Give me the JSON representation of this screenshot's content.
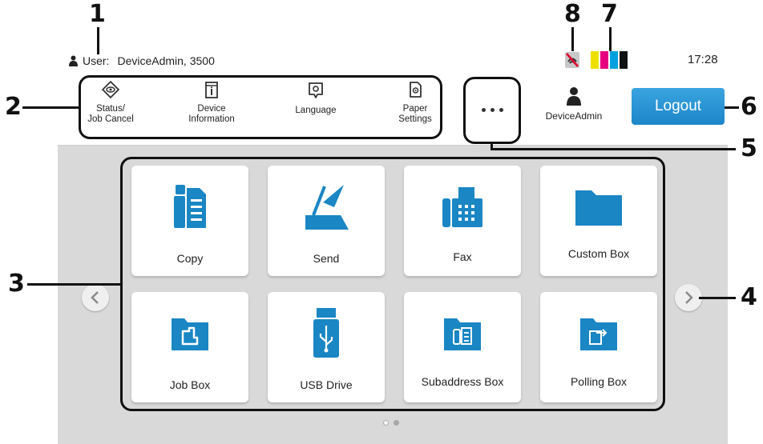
{
  "status_bar": {
    "user_label": "User:",
    "user_value": "DeviceAdmin, 3500",
    "time": "17:28"
  },
  "quick_settings": [
    {
      "label_line1": "Status/",
      "label_line2": "Job Cancel",
      "icon": "status-eye-icon"
    },
    {
      "label_line1": "Device",
      "label_line2": "Information",
      "icon": "device-info-icon"
    },
    {
      "label_line1": "Language",
      "label_line2": "",
      "icon": "language-icon"
    },
    {
      "label_line1": "Paper",
      "label_line2": "Settings",
      "icon": "paper-settings-icon"
    }
  ],
  "more_button": {
    "icon": "more-dots-icon"
  },
  "account": {
    "name": "DeviceAdmin",
    "icon": "user-icon"
  },
  "logout": {
    "label": "Logout",
    "color": "#1d86c9"
  },
  "toner_colors": [
    "#f0e000",
    "#e6007e",
    "#00a0e0",
    "#111111"
  ],
  "tiles": [
    {
      "label": "Copy",
      "icon": "copy-icon"
    },
    {
      "label": "Send",
      "icon": "send-icon"
    },
    {
      "label": "Fax",
      "icon": "fax-icon"
    },
    {
      "label": "Custom Box",
      "icon": "folder-icon"
    },
    {
      "label": "Job Box",
      "icon": "job-box-icon"
    },
    {
      "label": "USB Drive",
      "icon": "usb-drive-icon"
    },
    {
      "label": "Subaddress Box",
      "icon": "subaddress-box-icon"
    },
    {
      "label": "Polling Box",
      "icon": "polling-box-icon"
    }
  ],
  "pagination": {
    "pages": 2,
    "current": 1
  },
  "callouts": [
    "1",
    "2",
    "3",
    "4",
    "5",
    "6",
    "7",
    "8"
  ],
  "accent_color": "#1a86c4"
}
